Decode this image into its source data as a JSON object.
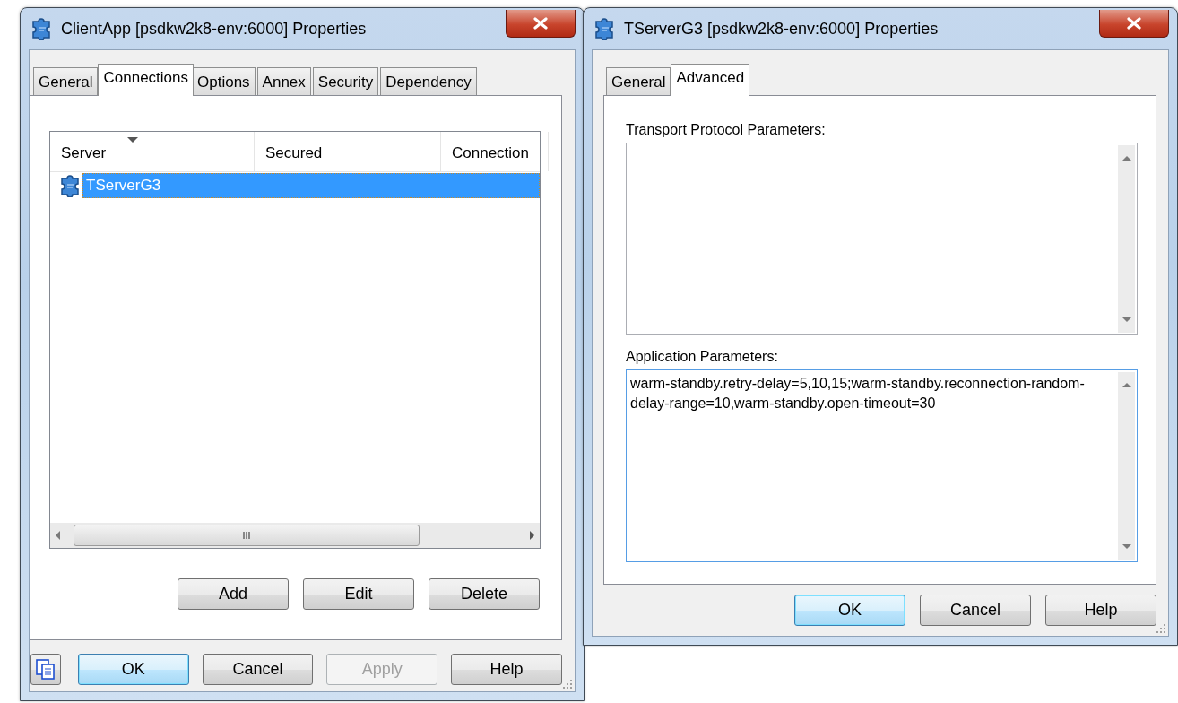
{
  "windows": [
    {
      "kind": "list",
      "title": "ClientApp [psdkw2k8-env:6000] Properties",
      "tabs": [
        {
          "label": "General",
          "selected": false
        },
        {
          "label": "Connections",
          "selected": true
        },
        {
          "label": "Options",
          "selected": false
        },
        {
          "label": "Annex",
          "selected": false
        },
        {
          "label": "Security",
          "selected": false
        },
        {
          "label": "Dependency",
          "selected": false
        }
      ],
      "list": {
        "columns": [
          {
            "label": "Server",
            "sorted": true
          },
          {
            "label": "Secured",
            "sorted": false
          },
          {
            "label": "Connection",
            "sorted": false
          }
        ],
        "rows": [
          {
            "server": "TServerG3",
            "selected": true
          }
        ]
      },
      "panel_buttons": [
        {
          "label": "Add"
        },
        {
          "label": "Edit"
        },
        {
          "label": "Delete"
        }
      ],
      "buttons": [
        {
          "kind": "icon",
          "default": false,
          "disabled": false
        },
        {
          "kind": "text",
          "label": "OK",
          "default": true,
          "disabled": false
        },
        {
          "kind": "text",
          "label": "Cancel",
          "default": false,
          "disabled": false
        },
        {
          "kind": "text",
          "label": "Apply",
          "default": false,
          "disabled": true
        },
        {
          "kind": "text",
          "label": "Help",
          "default": false,
          "disabled": false
        }
      ]
    },
    {
      "kind": "fields",
      "title": "TServerG3 [psdkw2k8-env:6000] Properties",
      "tabs": [
        {
          "label": "General",
          "selected": false
        },
        {
          "label": "Advanced",
          "selected": true
        }
      ],
      "fields": [
        {
          "label": "Transport Protocol Parameters:",
          "focused": false
        },
        {
          "label": "Application Parameters:",
          "value": "warm-standby.retry-delay=5,10,15;warm-standby.reconnection-random-delay-range=10,warm-standby.open-timeout=30",
          "focused": true
        }
      ],
      "buttons": [
        {
          "kind": "text",
          "label": "OK",
          "default": true,
          "disabled": false
        },
        {
          "kind": "text",
          "label": "Cancel",
          "default": false,
          "disabled": false
        },
        {
          "kind": "text",
          "label": "Help",
          "default": false,
          "disabled": false
        }
      ]
    }
  ]
}
